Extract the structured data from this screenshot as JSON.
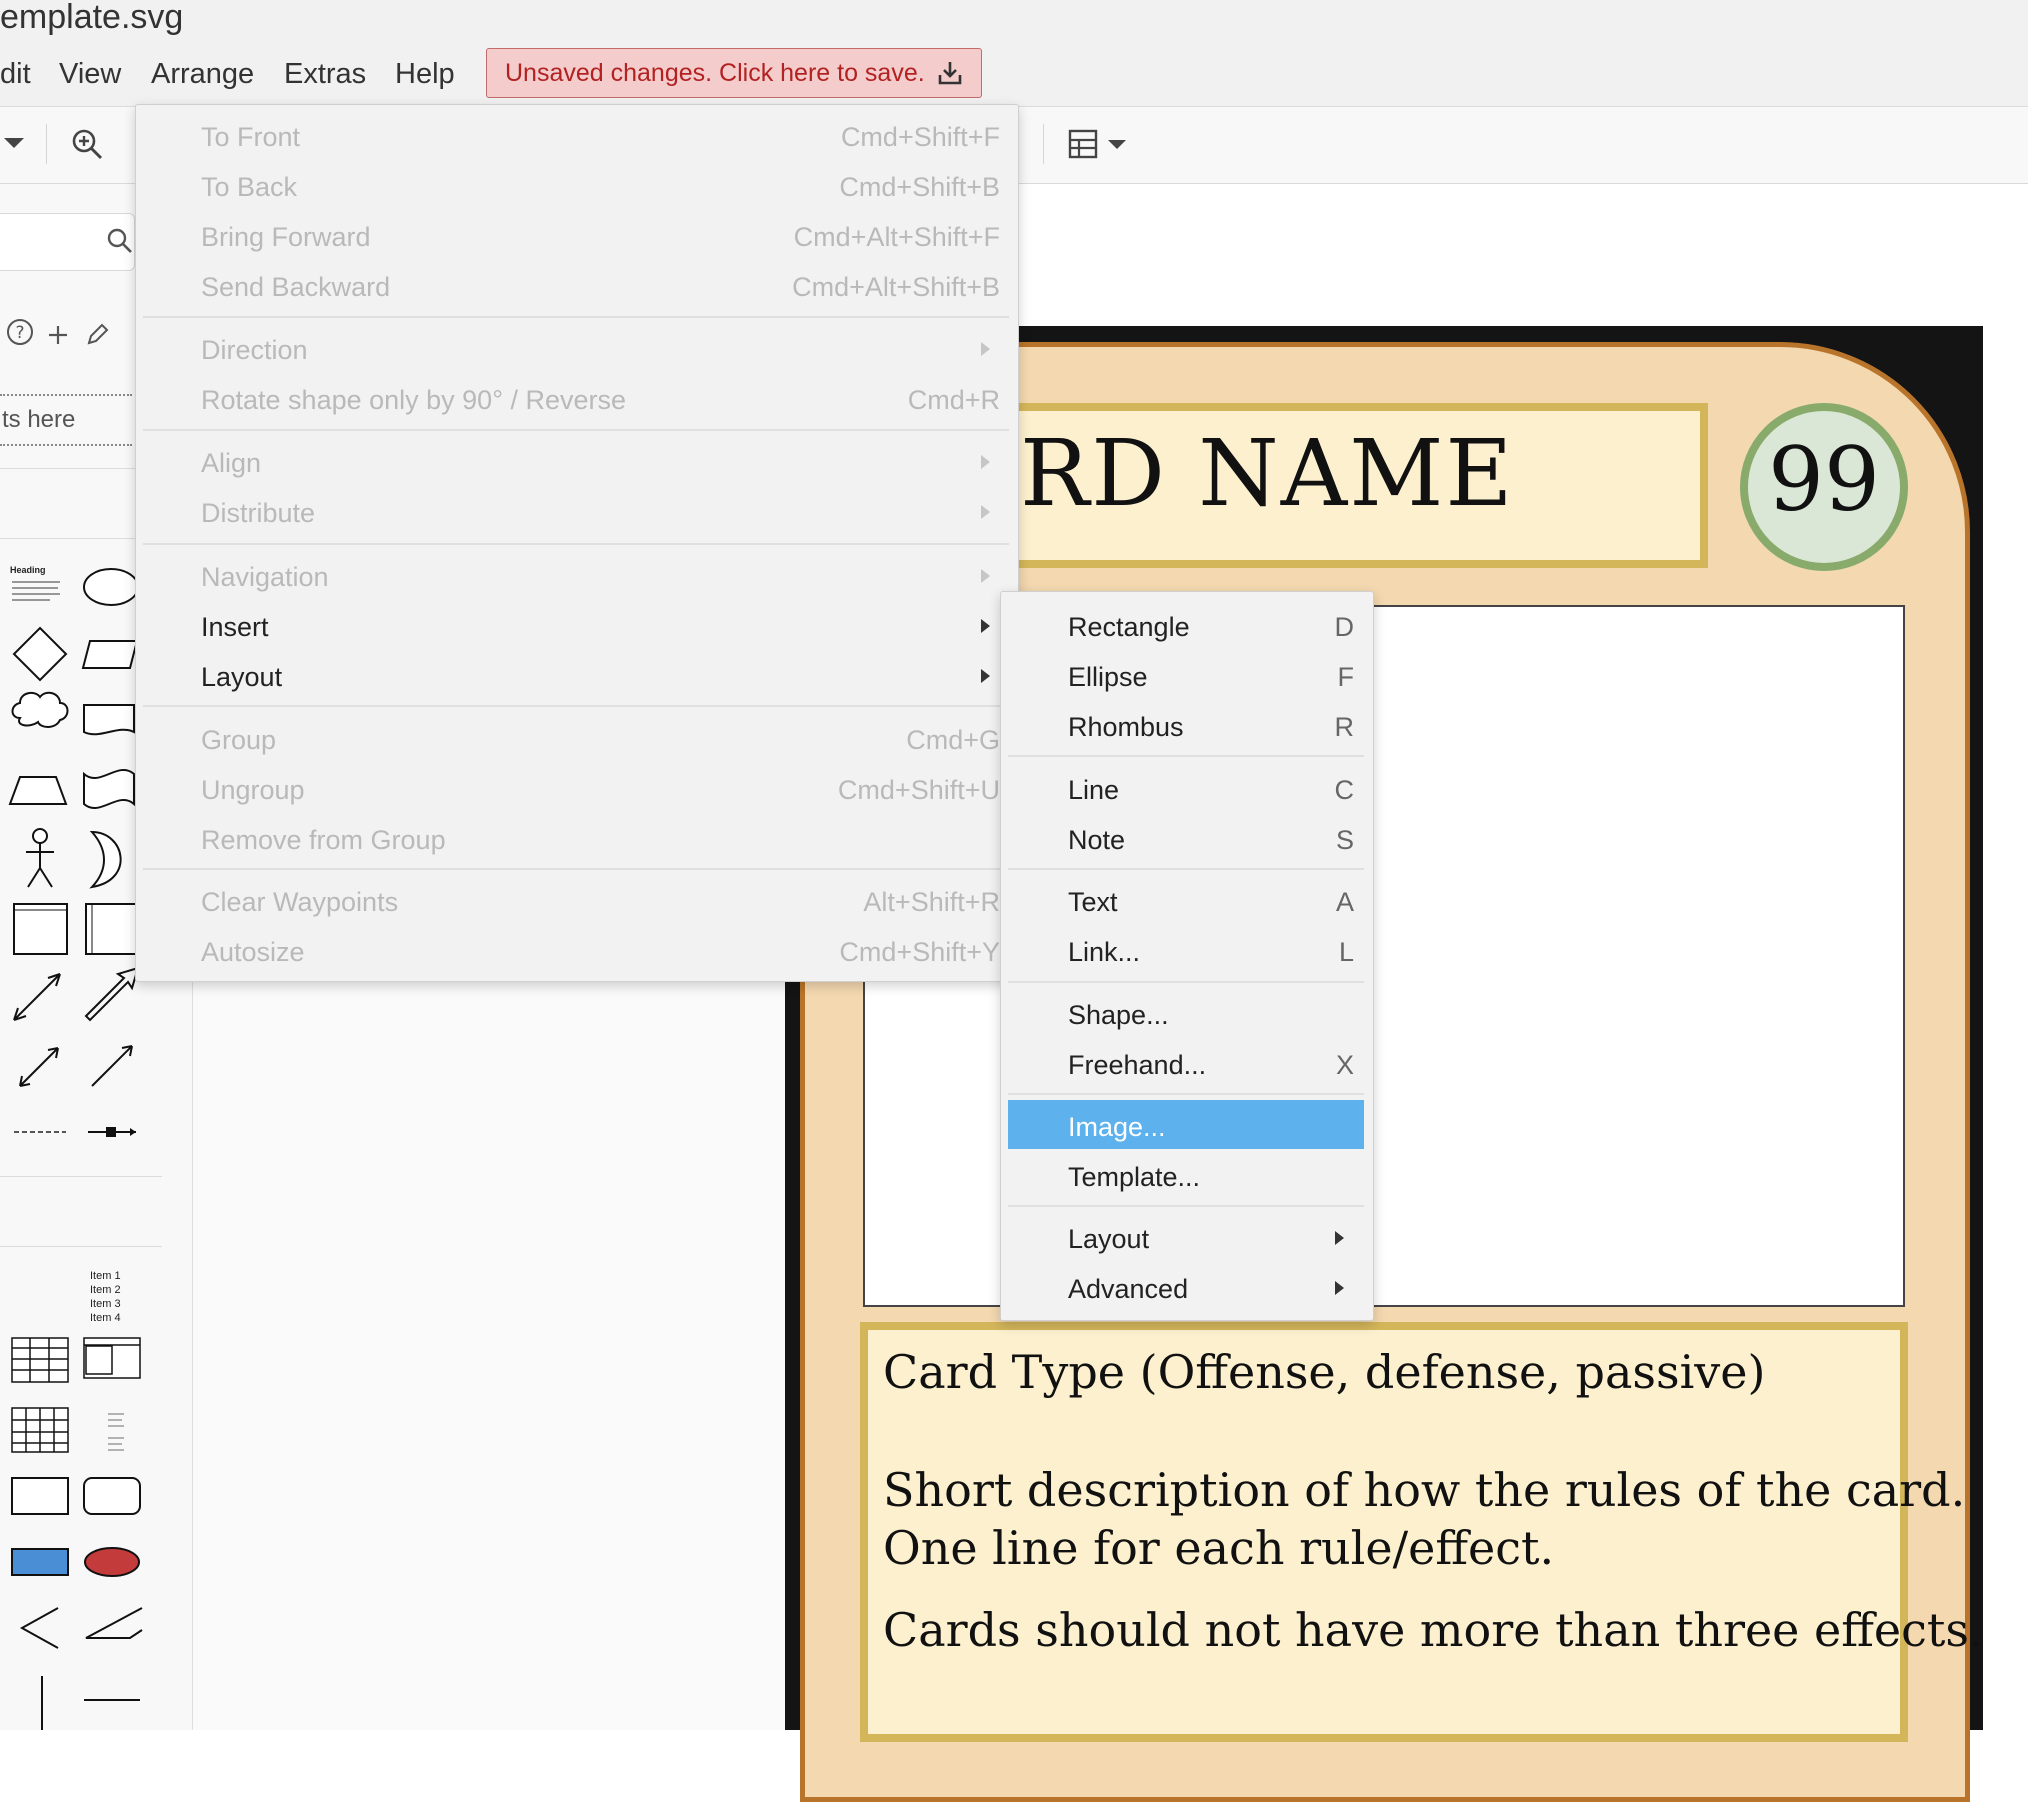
{
  "window": {
    "title": "emplate.svg"
  },
  "menubar": {
    "items": [
      "dit",
      "View",
      "Arrange",
      "Extras",
      "Help"
    ],
    "save_notice": "Unsaved changes. Click here to save."
  },
  "sidebar": {
    "drop_text": "ts here"
  },
  "card": {
    "name": "RD NAME",
    "cost": "99",
    "type_line": "Card Type (Offense, defense, passive)",
    "rule_line_1": "Short description of how the rules of the card.",
    "rule_line_2": "One line for each rule/effect.",
    "rule_line_3": "Cards should not have more than three effects."
  },
  "arrange_menu": {
    "items": [
      {
        "label": "To Front",
        "shortcut": "Cmd+Shift+F"
      },
      {
        "label": "To Back",
        "shortcut": "Cmd+Shift+B"
      },
      {
        "label": "Bring Forward",
        "shortcut": "Cmd+Alt+Shift+F"
      },
      {
        "label": "Send Backward",
        "shortcut": "Cmd+Alt+Shift+B"
      },
      {
        "label": "Direction",
        "shortcut": ""
      },
      {
        "label": "Rotate shape only by 90° / Reverse",
        "shortcut": "Cmd+R"
      },
      {
        "label": "Align",
        "shortcut": ""
      },
      {
        "label": "Distribute",
        "shortcut": ""
      },
      {
        "label": "Navigation",
        "shortcut": ""
      },
      {
        "label": "Insert",
        "shortcut": ""
      },
      {
        "label": "Layout",
        "shortcut": ""
      },
      {
        "label": "Group",
        "shortcut": "Cmd+G"
      },
      {
        "label": "Ungroup",
        "shortcut": "Cmd+Shift+U"
      },
      {
        "label": "Remove from Group",
        "shortcut": ""
      },
      {
        "label": "Clear Waypoints",
        "shortcut": "Alt+Shift+R"
      },
      {
        "label": "Autosize",
        "shortcut": "Cmd+Shift+Y"
      }
    ]
  },
  "insert_menu": {
    "items": [
      {
        "label": "Rectangle",
        "shortcut": "D"
      },
      {
        "label": "Ellipse",
        "shortcut": "F"
      },
      {
        "label": "Rhombus",
        "shortcut": "R"
      },
      {
        "label": "Line",
        "shortcut": "C"
      },
      {
        "label": "Note",
        "shortcut": "S"
      },
      {
        "label": "Text",
        "shortcut": "A"
      },
      {
        "label": "Link...",
        "shortcut": "L"
      },
      {
        "label": "Shape...",
        "shortcut": ""
      },
      {
        "label": "Freehand...",
        "shortcut": "X"
      },
      {
        "label": "Image...",
        "shortcut": ""
      },
      {
        "label": "Template...",
        "shortcut": ""
      },
      {
        "label": "Layout",
        "shortcut": ""
      },
      {
        "label": "Advanced",
        "shortcut": ""
      }
    ],
    "highlighted": "Image..."
  },
  "shape_library": {
    "heading_sample": "Heading",
    "list_items": [
      "Item 1",
      "Item 2",
      "Item 3",
      "Item 4"
    ]
  },
  "colors": {
    "save_bg": "#f4cccc",
    "save_text": "#b22222",
    "menu_highlight": "#5db1ec",
    "card_frame": "#f3d8b0",
    "card_panel": "#fcf0cf",
    "cost_ring": "#88aa6a"
  }
}
